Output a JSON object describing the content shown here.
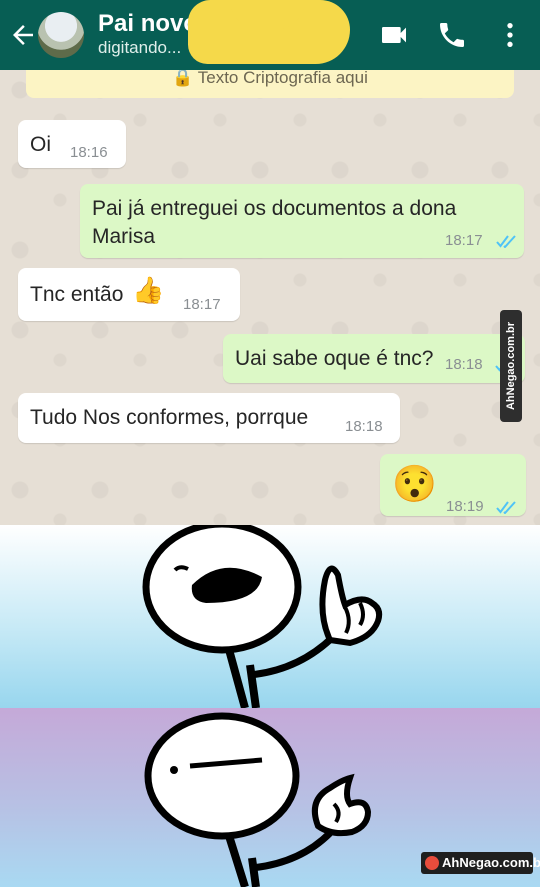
{
  "header": {
    "contact_name": "Pai novo",
    "contact_status": "digitando...",
    "icons": [
      "back-arrow-icon",
      "video-call-icon",
      "phone-icon",
      "more-vertical-icon"
    ]
  },
  "chat": {
    "encryption_notice": "Texto Criptografia aqui",
    "messages": [
      {
        "direction": "in",
        "text": "Oi",
        "time": "18:16"
      },
      {
        "direction": "out",
        "text_line1": "Pai já entreguei os documentos a dona",
        "text_line2": "Marisa",
        "time": "18:17",
        "read": true
      },
      {
        "direction": "in",
        "text": "Tnc então",
        "emoji": "👍",
        "time": "18:17"
      },
      {
        "direction": "out",
        "text": "Uai sabe oque é tnc?",
        "time": "18:18",
        "read": true
      },
      {
        "direction": "in",
        "text": "Tudo Nos conformes, porrque",
        "time": "18:18"
      },
      {
        "direction": "out",
        "emoji": "😯",
        "time": "18:19",
        "read": true
      }
    ],
    "side_watermark": "AhNegao.com.br"
  },
  "meme": {
    "bottom_watermark": "AhNegao.com.br",
    "colors": {
      "panel1": "#98d6ee",
      "panel2": "#c5a9d8"
    }
  },
  "colors": {
    "header": "#075e54",
    "outgoing": "#dcf8c6",
    "incoming": "#ffffff",
    "ticks": "#4fc3f7",
    "censor": "#f5d94a"
  }
}
